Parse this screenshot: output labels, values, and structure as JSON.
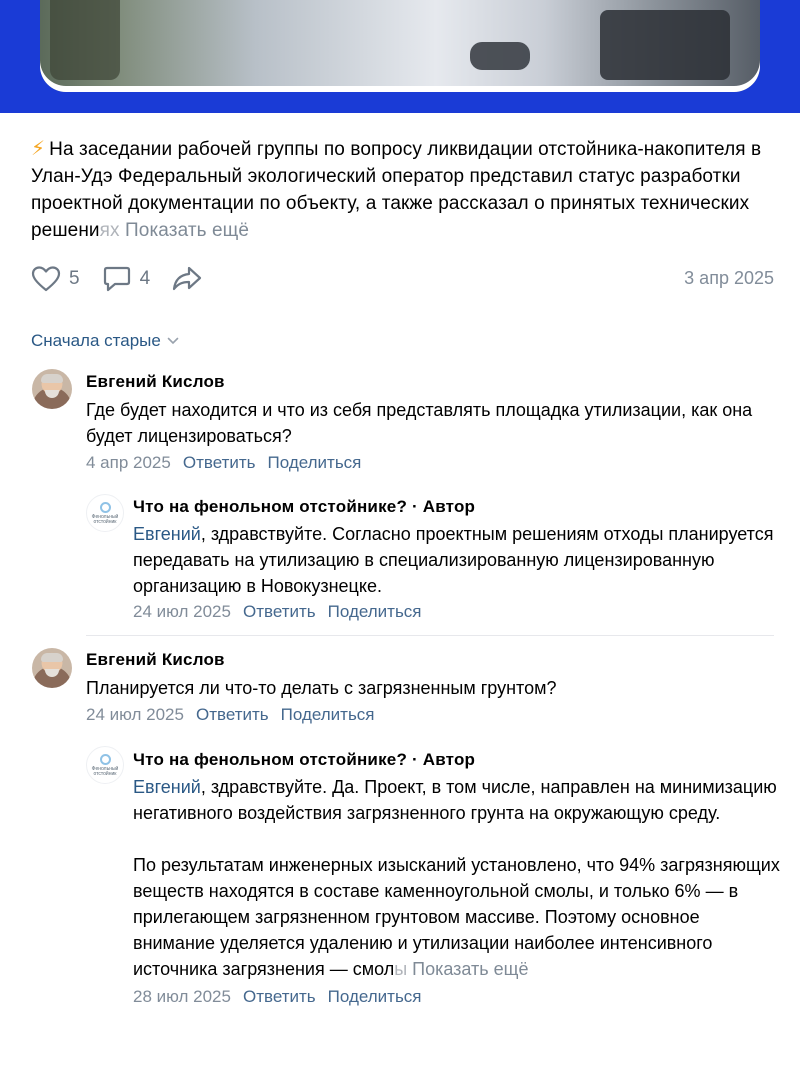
{
  "post": {
    "text_main": "На заседании рабочей группы по вопросу ликвидации отстойника-накопителя в Улан-Удэ Федеральный экологический оператор представил статус разработки проектной документации по объекту, а также рассказал о принятых технических решени",
    "text_fade": "ях",
    "show_more": "Показать ещё",
    "likes": "5",
    "comments": "4",
    "date": "3 апр 2025"
  },
  "sort_label": "Сначала старые",
  "comments": [
    {
      "author": "Евгений Кислов",
      "text": "Где будет находится и что из себя представлять площадка утилизации, как она будет лицензироваться?",
      "date": "4 апр 2025",
      "reply": "Ответить",
      "share": "Поделиться"
    },
    {
      "author": "Что на фенольном отстойнике? · Автор",
      "mention": "Евгений",
      "text": ", здравствуйте. Согласно проектным решениям отходы планируется передавать на утилизацию в специализированную лицензированную организацию в Новокузнецке.",
      "date": "24 июл 2025",
      "reply": "Ответить",
      "share": "Поделиться"
    },
    {
      "author": "Евгений Кислов",
      "text": "Планируется ли что-то делать с загрязненным грунтом?",
      "date": "24 июл 2025",
      "reply": "Ответить",
      "share": "Поделиться"
    },
    {
      "author": "Что на фенольном отстойнике? · Автор",
      "mention": "Евгений",
      "text": ", здравствуйте. Да. Проект, в том числе, направлен на минимизацию негативного воздействия загрязненного грунта на окружающую среду.",
      "text2": "По результатам инженерных изысканий установлено, что 94% загрязняющих веществ находятся в составе каменноугольной смолы, и только 6% — в прилегающем загрязненном грунтовом массиве. Поэтому основное внимание уделяется удалению и утилизации наиболее интенсивного источника загрязнения — смол",
      "text2_fade": "ы",
      "show_more": "Показать ещё",
      "date": "28 июл 2025",
      "reply": "Ответить",
      "share": "Поделиться"
    }
  ],
  "org_avatar_text": "Фенольный отстойник",
  "colors": {
    "header_blue": "#1a3bd6",
    "link": "#45688e",
    "meta": "#818c99",
    "bolt": "#f5a623"
  },
  "icons": [
    "lightning-icon",
    "heart-icon",
    "comment-icon",
    "share-icon",
    "chevron-down-icon"
  ]
}
